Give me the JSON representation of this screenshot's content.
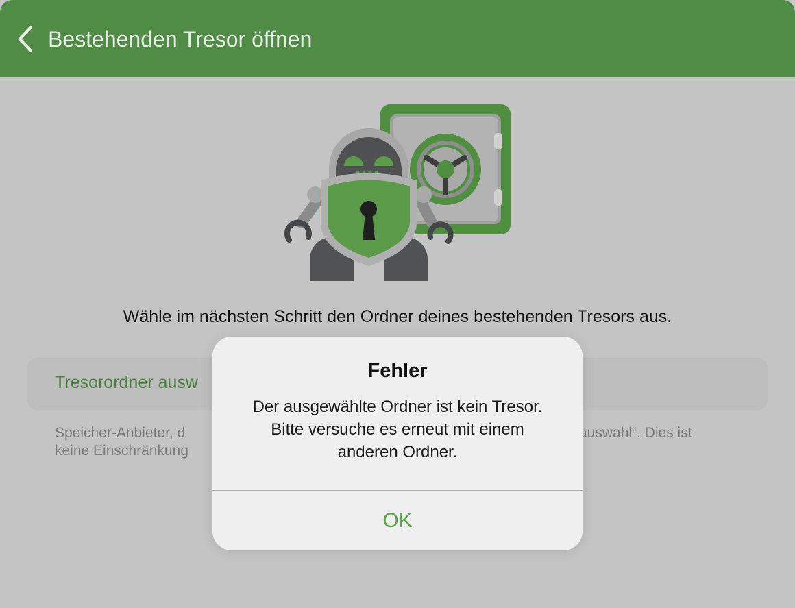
{
  "navbar": {
    "back_icon": "chevron-left-icon",
    "title": "Bestehenden Tresor öffnen",
    "background_color": "#508c45"
  },
  "illustration": {
    "icon": "robot-with-safe-illustration"
  },
  "instruction": "Wähle im nächsten Schritt den Ordner deines bestehenden Tresors aus.",
  "select_folder": {
    "label": "Tresorordner ausw"
  },
  "footer_hint": {
    "line1_left": "Speicher-Anbieter, d",
    "line1_right": "auswahl“. Dies ist",
    "line2": "keine Einschränkung"
  },
  "alert": {
    "title": "Fehler",
    "message": "Der ausgewählte Ordner ist kein Tresor. Bitte versuche es erneut mit einem anderen Ordner.",
    "ok_label": "OK",
    "accent_color": "#55a544"
  }
}
